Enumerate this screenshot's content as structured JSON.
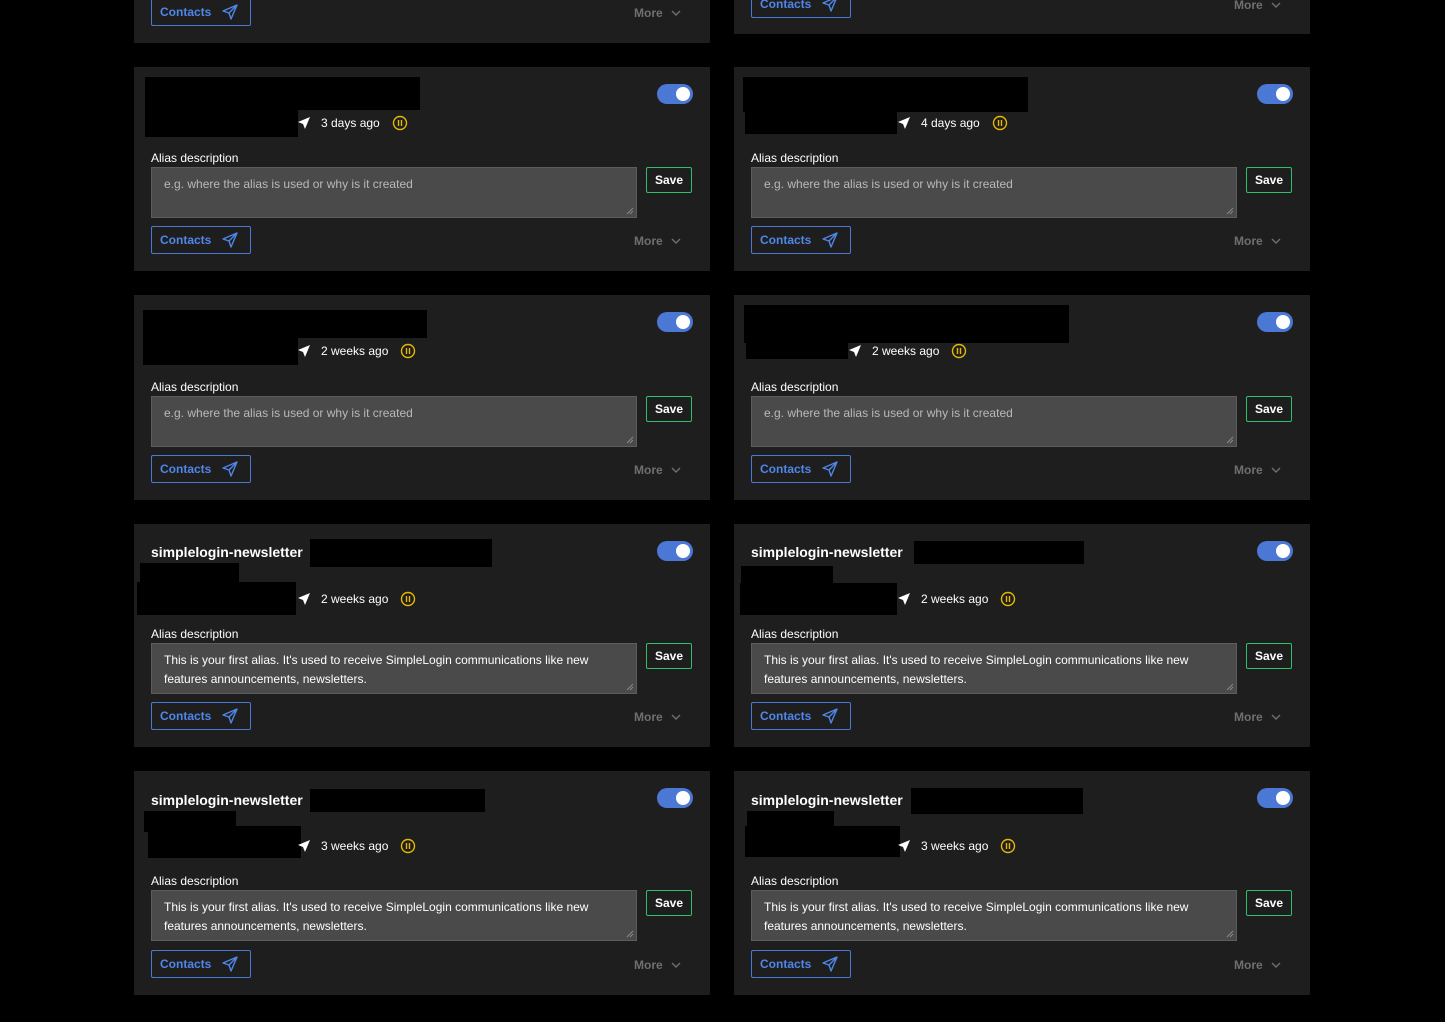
{
  "common": {
    "alias_description_label": "Alias description",
    "placeholder": "e.g. where the alias is used or why is it created",
    "save_label": "Save",
    "contacts_label": "Contacts",
    "more_label": "More",
    "alias_prefix": "simplelogin-newsletter",
    "first_alias_desc": "This is your first alias. It's used to receive SimpleLogin communications like new features announcements, newsletters.",
    "accent_color": "#4a78d4",
    "save_border_color": "#2fbf6a",
    "pause_icon_color": "#e6b800"
  },
  "cards": [
    {
      "time": "",
      "enabled": true
    },
    {
      "time": "",
      "enabled": true
    },
    {
      "time": "3 days ago",
      "enabled": true
    },
    {
      "time": "4 days ago",
      "enabled": true
    },
    {
      "time": "2 weeks ago",
      "enabled": true
    },
    {
      "time": "2 weeks ago",
      "enabled": true
    },
    {
      "time": "2 weeks ago",
      "enabled": true
    },
    {
      "time": "2 weeks ago",
      "enabled": true
    },
    {
      "time": "3 weeks ago",
      "enabled": true
    },
    {
      "time": "3 weeks ago",
      "enabled": true
    }
  ]
}
